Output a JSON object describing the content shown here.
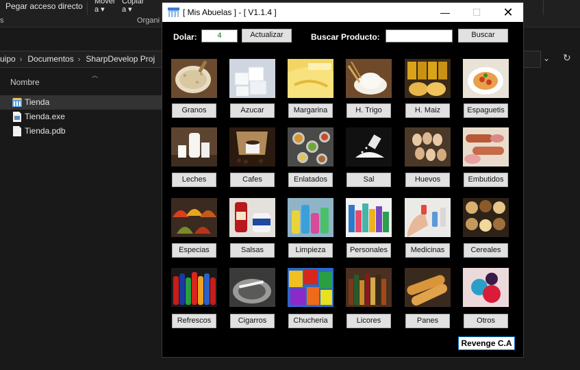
{
  "explorer": {
    "ribbon": {
      "pin_label": "Pegar acceso directo",
      "move_label": "Mover\na ▾",
      "copy_label": "Copiar\na ▾",
      "group_left": "s",
      "group_organize": "Organi"
    },
    "breadcrumb": [
      "uipo",
      "Documentos",
      "SharpDevelop Proj"
    ],
    "column_header": "Nombre",
    "files": [
      {
        "name": "Tienda",
        "icon": "app-folder-icon",
        "selected": true
      },
      {
        "name": "Tienda.exe",
        "icon": "exe-file-icon",
        "selected": false
      },
      {
        "name": "Tienda.pdb",
        "icon": "document-file-icon",
        "selected": false
      }
    ]
  },
  "window": {
    "title": "[ Mis Abuelas ] - [ V1.1.4 ]",
    "controls": {
      "minimize": "—",
      "maximize": "☐",
      "close": "✕"
    },
    "toolbar": {
      "dolar_label": "Dolar:",
      "dolar_value": "4",
      "update_label": "Actualizar",
      "search_label": "Buscar Producto:",
      "search_value": "",
      "search_button": "Buscar"
    },
    "categories": [
      {
        "label": "Granos",
        "thumb": "rice-grains"
      },
      {
        "label": "Azucar",
        "thumb": "sugar-cubes"
      },
      {
        "label": "Margarina",
        "thumb": "margarine"
      },
      {
        "label": "H. Trigo",
        "thumb": "wheat-flour"
      },
      {
        "label": "H. Maiz",
        "thumb": "corn-flour-packs"
      },
      {
        "label": "Espaguetis",
        "thumb": "spaghetti"
      },
      {
        "label": "Leches",
        "thumb": "milk"
      },
      {
        "label": "Cafes",
        "thumb": "coffee"
      },
      {
        "label": "Enlatados",
        "thumb": "canned-food"
      },
      {
        "label": "Sal",
        "thumb": "salt"
      },
      {
        "label": "Huevos",
        "thumb": "eggs"
      },
      {
        "label": "Embutidos",
        "thumb": "sausages"
      },
      {
        "label": "Especias",
        "thumb": "spices"
      },
      {
        "label": "Salsas",
        "thumb": "sauces"
      },
      {
        "label": "Limpieza",
        "thumb": "cleaning"
      },
      {
        "label": "Personales",
        "thumb": "personal-care"
      },
      {
        "label": "Medicinas",
        "thumb": "medicine"
      },
      {
        "label": "Cereales",
        "thumb": "cereals"
      },
      {
        "label": "Refrescos",
        "thumb": "sodas"
      },
      {
        "label": "Cigarros",
        "thumb": "cigarettes"
      },
      {
        "label": "Chucheria",
        "thumb": "snacks"
      },
      {
        "label": "Licores",
        "thumb": "liquors"
      },
      {
        "label": "Panes",
        "thumb": "bread"
      },
      {
        "label": "Otros",
        "thumb": "apples"
      }
    ],
    "footer_label": "Revenge C.A"
  },
  "colors": {
    "app_background": "#000000",
    "explorer_background": "#191919",
    "dolar_text": "#0a7a0a"
  }
}
